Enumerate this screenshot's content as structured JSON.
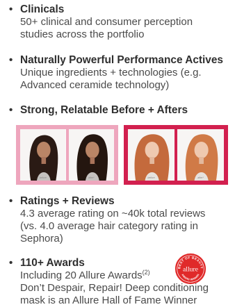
{
  "bullet_glyph": "•",
  "sections": {
    "clinicals": {
      "title": "Clinicals",
      "lines": [
        "50+ clinical and consumer perception",
        "studies across the portfolio"
      ]
    },
    "actives": {
      "title": "Naturally Powerful Performance Actives",
      "lines": [
        "Unique ingredients + technologies (e.g.",
        "Advanced ceramide technology)"
      ]
    },
    "before_afters": {
      "title": "Strong, Relatable Before + Afters",
      "panels": [
        {
          "before_caption": "before",
          "after_caption": "after*",
          "frame_color": "#eea6bd"
        },
        {
          "before_caption": "before",
          "after_caption": "after*",
          "frame_color": "#d2204f"
        }
      ]
    },
    "ratings": {
      "title": "Ratings + Reviews",
      "lines": [
        "4.3 average rating on ~40k total reviews",
        "(vs. 4.0 average hair category rating in",
        "Sephora)"
      ]
    },
    "awards": {
      "title": "110+ Awards",
      "line1_text": "Including 20 Allure Awards",
      "line1_sup": "(2)",
      "lines": [
        "Don’t Despair, Repair! Deep conditioning",
        "mask is an Allure Hall of Fame Winner"
      ]
    }
  },
  "seal": {
    "brand": "allure",
    "ring_text": "BEST OF BEAUTY",
    "bottom_text": "AWARD WINNER",
    "color": "#e02a2a"
  },
  "colors": {
    "text_dark": "#2f2f2f",
    "text_body": "#4a4a4a",
    "pink_frame": "#eea6bd",
    "red_frame": "#d2204f"
  }
}
